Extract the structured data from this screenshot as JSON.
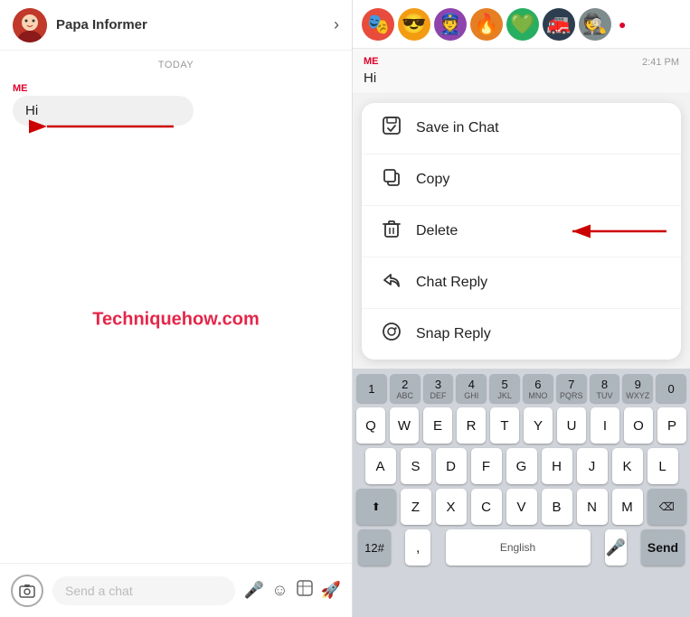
{
  "left": {
    "header": {
      "name": "Papa Informer",
      "chevron": "›"
    },
    "today_label": "TODAY",
    "message": {
      "sender": "ME",
      "text": "Hi"
    },
    "watermark": "Techniquehow.com",
    "bottom": {
      "input_placeholder": "Send a chat",
      "camera_icon": "⊙",
      "mic_icon": "🎤",
      "emoji_icon": "☺",
      "sticker_icon": "📋",
      "rocket_icon": "🚀"
    }
  },
  "right": {
    "avatars": [
      "🎭",
      "😎",
      "👮",
      "🔥",
      "💚",
      "🚒",
      "🕵️"
    ],
    "message": {
      "sender": "ME",
      "time": "2:41 PM",
      "text": "Hi"
    },
    "menu": {
      "items": [
        {
          "id": "save-in-chat",
          "icon": "save",
          "label": "Save in Chat"
        },
        {
          "id": "copy",
          "icon": "copy",
          "label": "Copy"
        },
        {
          "id": "delete",
          "icon": "trash",
          "label": "Delete",
          "has_arrow": true
        },
        {
          "id": "chat-reply",
          "icon": "reply",
          "label": "Chat Reply"
        },
        {
          "id": "snap-reply",
          "icon": "camera-circle",
          "label": "Snap Reply"
        }
      ]
    },
    "keyboard": {
      "numbers": [
        "1",
        "2",
        "3",
        "4",
        "5",
        "6",
        "7",
        "8",
        "9",
        "0"
      ],
      "row1": [
        "Q",
        "W",
        "E",
        "R",
        "T",
        "Y",
        "U",
        "I",
        "O",
        "P"
      ],
      "row2": [
        "A",
        "S",
        "D",
        "F",
        "G",
        "H",
        "J",
        "K",
        "L"
      ],
      "row3": [
        "Z",
        "X",
        "C",
        "V",
        "B",
        "N",
        "M"
      ],
      "nums_label": "12#",
      "space_label": "English",
      "send_label": "Send",
      "mic_label": "🎤",
      "period": ".",
      "comma": ","
    }
  }
}
